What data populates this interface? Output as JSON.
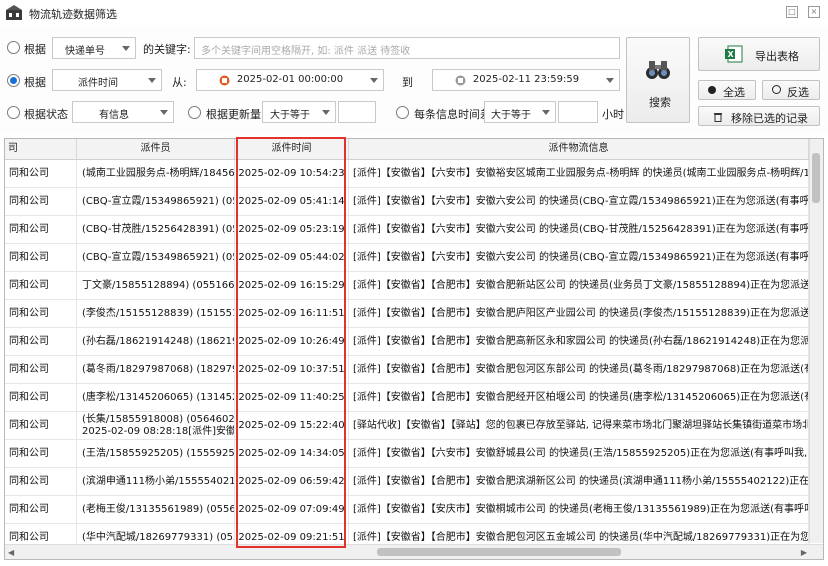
{
  "window": {
    "title": "物流轨迹数据筛选"
  },
  "filters": {
    "row1": {
      "radio_label": "根据",
      "field": "快递单号",
      "keyword_label": "的关键字:",
      "keyword_placeholder": "多个关键字间用空格隔开, 如: 派件 派送 待签收"
    },
    "row2": {
      "radio_label": "根据",
      "field": "派件时间",
      "from_label": "从:",
      "from_value": "2025-02-01 00:00:00",
      "to_label": "到",
      "to_value": "2025-02-11 23:59:59"
    },
    "row3": {
      "status_label": "根据状态",
      "status_value": "有信息",
      "update_label": "根据更新量",
      "update_op": "大于等于",
      "interval_label": "每条信息时间差",
      "interval_op": "大于等于",
      "unit": "小时"
    }
  },
  "actions": {
    "search": "搜索",
    "export": "导出表格",
    "select_all": "全选",
    "invert": "反选",
    "remove": "移除已选的记录"
  },
  "table": {
    "headers": [
      "司",
      "派件员",
      "派件时间",
      "派件物流信息"
    ],
    "rows": [
      {
        "c0": "同和公司",
        "c1": "(城南工业园服务点-杨明辉/18456",
        "c2": "2025-02-09 10:54:23",
        "c3": "[派件]【安徽省】【六安市】安徽裕安区城南工业园服务点-杨明辉 的快递员(城南工业园服务点-杨明辉/18456419"
      },
      {
        "c0": "同和公司",
        "c1": "(CBQ-宣立霞/15349865921) (0564",
        "c2": "2025-02-09 05:41:14",
        "c3": "[派件]【安徽省】【六安市】安徽六安公司 的快递员(CBQ-宣立霞/15349865921)正在为您派送(有事呼叫我"
      },
      {
        "c0": "同和公司",
        "c1": "(CBQ-甘茂胜/15256428391) (0564",
        "c2": "2025-02-09 05:23:19",
        "c3": "[派件]【安徽省】【六安市】安徽六安公司 的快递员(CBQ-甘茂胜/15256428391)正在为您派送(有事呼叫我"
      },
      {
        "c0": "同和公司",
        "c1": "(CBQ-宣立霞/15349865921) (0564",
        "c2": "2025-02-09 05:44:02",
        "c3": "[派件]【安徽省】【六安市】安徽六安公司 的快递员(CBQ-宣立霞/15349865921)正在为您派送(有事呼叫我"
      },
      {
        "c0": "同和公司",
        "c1": "丁文豪/15855128894) (055166163",
        "c2": "2025-02-09 16:15:29",
        "c3": "[派件]【安徽省】【合肥市】安徽合肥新站区公司 的快递员(业务员丁文豪/15855128894)正在为您派送(有"
      },
      {
        "c0": "同和公司",
        "c1": "(李俊杰/15155128839) (15155128",
        "c2": "2025-02-09 16:11:51",
        "c3": "[派件]【安徽省】【合肥市】安徽合肥庐阳区产业园公司 的快递员(李俊杰/15155128839)正在为您派送(有"
      },
      {
        "c0": "同和公司",
        "c1": "(孙右磊/18621914248) (18621914",
        "c2": "2025-02-09 10:26:49",
        "c3": "[派件]【安徽省】【合肥市】安徽合肥高新区永和家园公司 的快递员(孙右磊/18621914248)正在为您派送"
      },
      {
        "c0": "同和公司",
        "c1": "(葛冬雨/18297987068) (18297987",
        "c2": "2025-02-09 10:37:51",
        "c3": "[派件]【安徽省】【合肥市】安徽合肥包河区东部公司 的快递员(葛冬雨/18297987068)正在为您派送(有事"
      },
      {
        "c0": "同和公司",
        "c1": "(唐李松/13145206065) (13145206",
        "c2": "2025-02-09 11:40:25",
        "c3": "[派件]【安徽省】【合肥市】安徽合肥经开区柏堰公司 的快递员(唐李松/13145206065)正在为您派送(有事"
      },
      {
        "c0": "同和公司",
        "c1": "(长集/15855918008) (0564602058\n2025-02-09 08:28:18[派件]安徽",
        "c2": "2025-02-09 15:22:40",
        "c3": "[驿站代收]【安徽省】【驿站】您的包裹已存放至驿站, 记得来菜市场北门聚湖坦驿站长集镇街道菜市场北"
      },
      {
        "c0": "同和公司",
        "c1": "(王浩/15855925205) (155592520",
        "c2": "2025-02-09 14:34:05",
        "c3": "[派件]【安徽省】【六安市】安徽舒城县公司 的快递员(王浩/15855925205)正在为您派送(有事呼叫我, 约"
      },
      {
        "c0": "同和公司",
        "c1": "(滨湖申通111杨小弟/15555402122",
        "c2": "2025-02-09 06:59:42",
        "c3": "[派件]【安徽省】【合肥市】安徽合肥滨湖新区公司 的快递员(滨湖申通111杨小弟/15555402122)正在为您"
      },
      {
        "c0": "同和公司",
        "c1": "(老梅王俊/13135561989) (0556-6",
        "c2": "2025-02-09 07:09:49",
        "c3": "[派件]【安徽省】【安庆市】安徽桐城市公司 的快递员(老梅王俊/13135561989)正在为您派送(有事呼叫我"
      },
      {
        "c0": "同和公司",
        "c1": "(华中汽配城/18269779331) (0551",
        "c2": "2025-02-09 09:21:51",
        "c3": "[派件]【安徽省】【合肥市】安徽合肥包河区五金城公司 的快递员(华中汽配城/18269779331)正在为您派送"
      }
    ]
  }
}
